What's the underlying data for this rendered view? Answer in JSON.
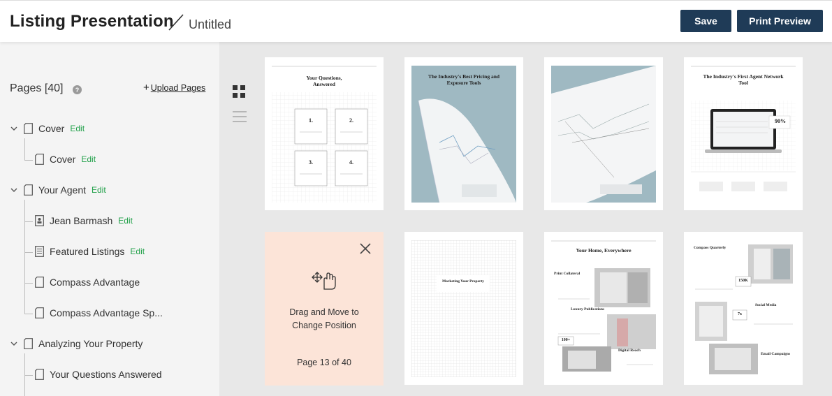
{
  "header": {
    "title": "Listing Presentation",
    "doc_name": "Untitled",
    "save_label": "Save",
    "print_label": "Print Preview"
  },
  "sidebar": {
    "pages_title": "Pages [40]",
    "help": "?",
    "upload_plus": "+",
    "upload_label": "Upload Pages",
    "edit_label": "Edit",
    "tree": [
      {
        "label": "Cover",
        "level": 1,
        "edit": true
      },
      {
        "label": "Cover",
        "level": 2,
        "edit": true
      },
      {
        "label": "Your Agent",
        "level": 1,
        "edit": true
      },
      {
        "label": "Jean Barmash",
        "level": 2,
        "edit": true
      },
      {
        "label": "Featured Listings",
        "level": 2,
        "edit": true
      },
      {
        "label": "Compass Advantage",
        "level": 2,
        "edit": false
      },
      {
        "label": "Compass Advantage Sp...",
        "level": 2,
        "edit": false
      },
      {
        "label": "Analyzing Your Property",
        "level": 1,
        "edit": false
      },
      {
        "label": "Your Questions Answered",
        "level": 2,
        "edit": false
      }
    ]
  },
  "thumbs": {
    "t1": {
      "title": "Your Questions, Answered",
      "q1": "1.",
      "q2": "2.",
      "q3": "3.",
      "q4": "4."
    },
    "t2": {
      "title": "The Industry's Best Pricing and Exposure Tools"
    },
    "t4": {
      "title": "The Industry's First Agent Network Tool",
      "badge": "90%"
    },
    "t6": {
      "title": "Marketing Your Property"
    },
    "t7": {
      "title": "Your Home, Everywhere",
      "s1": "Print Collateral",
      "s2": "Luxury Publications",
      "s3": "Digital Reach",
      "badge": "100+"
    },
    "t8": {
      "title": "Compass Quarterly",
      "b1": "150K",
      "b2": "7x",
      "s1": "Social Media",
      "s2": "Email Campaigns"
    }
  },
  "drag": {
    "line1": "Drag and Move to",
    "line2": "Change Position",
    "page_info": "Page 13 of 40"
  }
}
